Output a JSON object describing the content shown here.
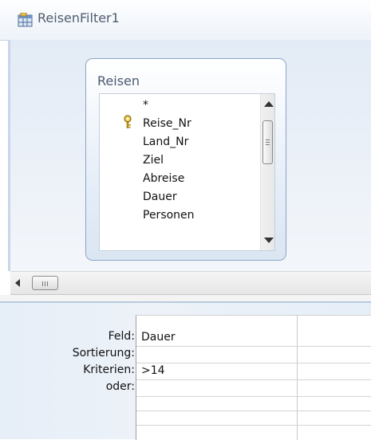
{
  "window": {
    "title": "ReisenFilter1",
    "title_icon": "query-design-icon"
  },
  "table_box": {
    "title": "Reisen",
    "fields": [
      {
        "name": "*",
        "key": false
      },
      {
        "name": "Reise_Nr",
        "key": true
      },
      {
        "name": "Land_Nr",
        "key": false
      },
      {
        "name": "Ziel",
        "key": false
      },
      {
        "name": "Abreise",
        "key": false
      },
      {
        "name": "Dauer",
        "key": false
      },
      {
        "name": "Personen",
        "key": false
      }
    ]
  },
  "grid": {
    "row_labels": {
      "field": "Feld:",
      "sort": "Sortierung:",
      "criteria": "Kriterien:",
      "or": "oder:"
    },
    "columns": [
      {
        "field": "Dauer",
        "sort": "",
        "criteria": ">14",
        "or": ""
      }
    ]
  },
  "colors": {
    "pane_blue": "#e3ebf6",
    "border_blue": "#8aa5c6"
  }
}
